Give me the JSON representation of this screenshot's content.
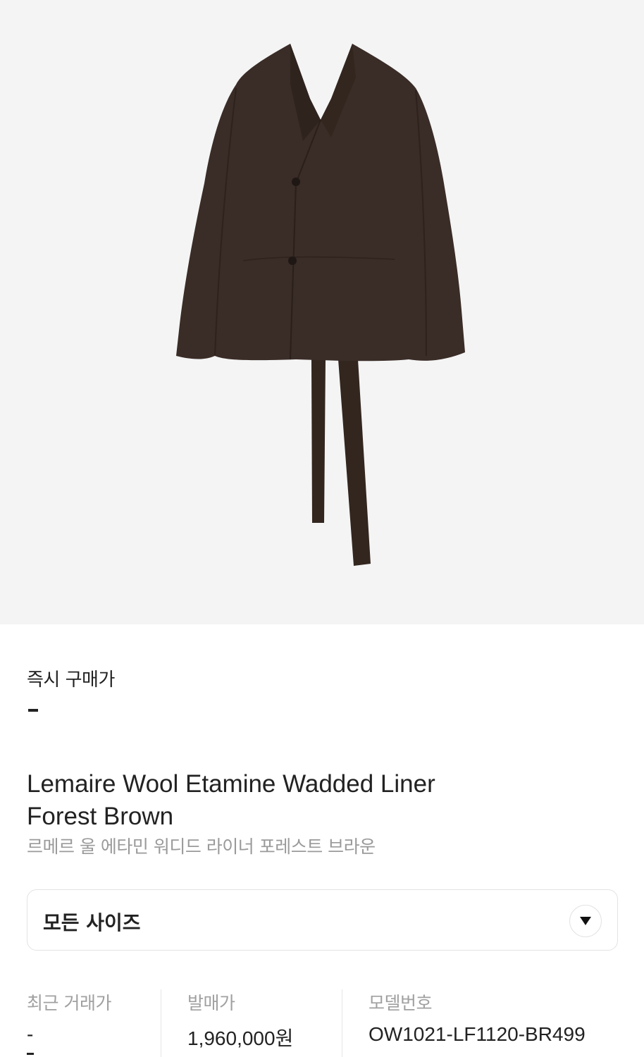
{
  "product": {
    "image_alt": "Lemaire Wool Etamine Wadded Liner Forest Brown",
    "colors": {
      "background": "#f4f4f4",
      "garment": "#3a2c27"
    }
  },
  "buy_now": {
    "label": "즉시 구매가",
    "value": "-"
  },
  "title": {
    "line1": "Lemaire Wool Etamine Wadded Liner",
    "line2": "Forest Brown"
  },
  "subtitle": "르메르 울 에타민 워디드 라이너 포레스트 브라운",
  "size_select": {
    "label": "모든 사이즈",
    "icon": "triangle-down-icon"
  },
  "stats": [
    {
      "label": "최근 거래가",
      "value": "-"
    },
    {
      "label": "발매가",
      "value": "1,960,000원"
    },
    {
      "label": "모델번호",
      "value": "OW1021-LF1120-BR499"
    }
  ]
}
